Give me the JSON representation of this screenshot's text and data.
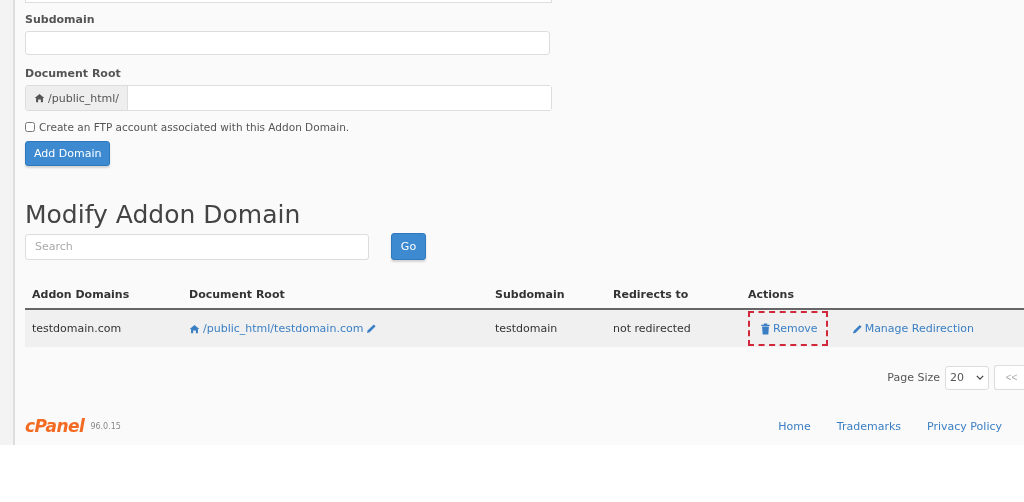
{
  "form": {
    "fields": [
      {
        "label": "Subdomain",
        "kind": "text"
      },
      {
        "label": "Document Root",
        "kind": "prefixed",
        "prefix": "/public_html/"
      }
    ],
    "ftp_checkbox": {
      "label": "Create an FTP account associated with this Addon Domain.",
      "checked": false
    },
    "submit_button": "Add Domain"
  },
  "modify": {
    "title": "Modify Addon Domain",
    "search": {
      "placeholder": "Search"
    },
    "go_button": "Go",
    "table": {
      "columns": [
        "Addon Domains",
        "Document Root",
        "Subdomain",
        "Redirects to",
        "Actions"
      ],
      "rows": [
        {
          "domain": "testdomain.com",
          "document_root": "/public_html/testdomain.com",
          "subdomain": "testdomain",
          "redirects_to": "not redirected",
          "actions": [
            {
              "label": "Remove",
              "kind": "remove",
              "highlighted": true
            },
            {
              "label": "Manage Redirection",
              "kind": "redirect",
              "highlighted": false
            }
          ]
        }
      ]
    },
    "pagination": {
      "page_size_label": "Page Size",
      "page_size": "20",
      "first_button": "<<"
    }
  },
  "footer": {
    "logo": "cPanel",
    "version": "96.0.15",
    "links": [
      "Home",
      "Trademarks",
      "Privacy Policy"
    ]
  }
}
